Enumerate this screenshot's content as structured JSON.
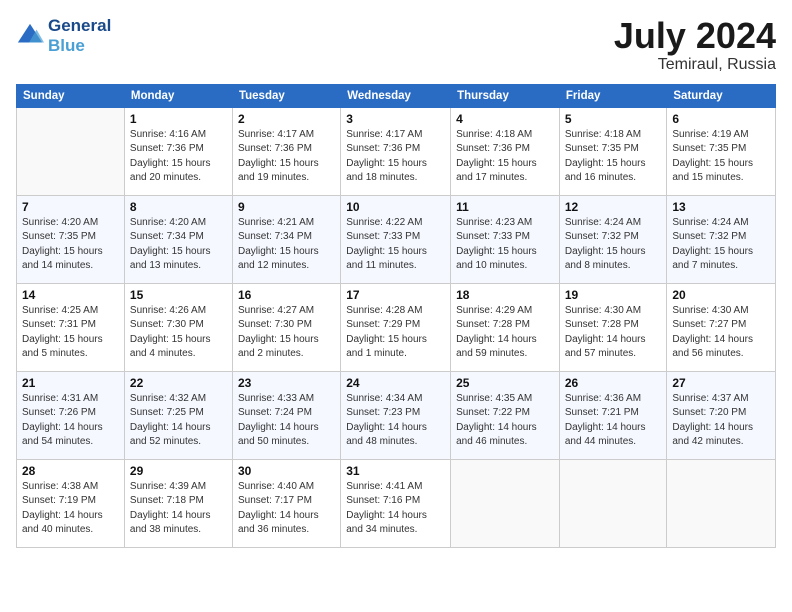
{
  "header": {
    "logo_line1": "General",
    "logo_line2": "Blue",
    "month": "July 2024",
    "location": "Temiraul, Russia"
  },
  "weekdays": [
    "Sunday",
    "Monday",
    "Tuesday",
    "Wednesday",
    "Thursday",
    "Friday",
    "Saturday"
  ],
  "weeks": [
    [
      {
        "day": "",
        "info": ""
      },
      {
        "day": "1",
        "info": "Sunrise: 4:16 AM\nSunset: 7:36 PM\nDaylight: 15 hours\nand 20 minutes."
      },
      {
        "day": "2",
        "info": "Sunrise: 4:17 AM\nSunset: 7:36 PM\nDaylight: 15 hours\nand 19 minutes."
      },
      {
        "day": "3",
        "info": "Sunrise: 4:17 AM\nSunset: 7:36 PM\nDaylight: 15 hours\nand 18 minutes."
      },
      {
        "day": "4",
        "info": "Sunrise: 4:18 AM\nSunset: 7:36 PM\nDaylight: 15 hours\nand 17 minutes."
      },
      {
        "day": "5",
        "info": "Sunrise: 4:18 AM\nSunset: 7:35 PM\nDaylight: 15 hours\nand 16 minutes."
      },
      {
        "day": "6",
        "info": "Sunrise: 4:19 AM\nSunset: 7:35 PM\nDaylight: 15 hours\nand 15 minutes."
      }
    ],
    [
      {
        "day": "7",
        "info": "Sunrise: 4:20 AM\nSunset: 7:35 PM\nDaylight: 15 hours\nand 14 minutes."
      },
      {
        "day": "8",
        "info": "Sunrise: 4:20 AM\nSunset: 7:34 PM\nDaylight: 15 hours\nand 13 minutes."
      },
      {
        "day": "9",
        "info": "Sunrise: 4:21 AM\nSunset: 7:34 PM\nDaylight: 15 hours\nand 12 minutes."
      },
      {
        "day": "10",
        "info": "Sunrise: 4:22 AM\nSunset: 7:33 PM\nDaylight: 15 hours\nand 11 minutes."
      },
      {
        "day": "11",
        "info": "Sunrise: 4:23 AM\nSunset: 7:33 PM\nDaylight: 15 hours\nand 10 minutes."
      },
      {
        "day": "12",
        "info": "Sunrise: 4:24 AM\nSunset: 7:32 PM\nDaylight: 15 hours\nand 8 minutes."
      },
      {
        "day": "13",
        "info": "Sunrise: 4:24 AM\nSunset: 7:32 PM\nDaylight: 15 hours\nand 7 minutes."
      }
    ],
    [
      {
        "day": "14",
        "info": "Sunrise: 4:25 AM\nSunset: 7:31 PM\nDaylight: 15 hours\nand 5 minutes."
      },
      {
        "day": "15",
        "info": "Sunrise: 4:26 AM\nSunset: 7:30 PM\nDaylight: 15 hours\nand 4 minutes."
      },
      {
        "day": "16",
        "info": "Sunrise: 4:27 AM\nSunset: 7:30 PM\nDaylight: 15 hours\nand 2 minutes."
      },
      {
        "day": "17",
        "info": "Sunrise: 4:28 AM\nSunset: 7:29 PM\nDaylight: 15 hours\nand 1 minute."
      },
      {
        "day": "18",
        "info": "Sunrise: 4:29 AM\nSunset: 7:28 PM\nDaylight: 14 hours\nand 59 minutes."
      },
      {
        "day": "19",
        "info": "Sunrise: 4:30 AM\nSunset: 7:28 PM\nDaylight: 14 hours\nand 57 minutes."
      },
      {
        "day": "20",
        "info": "Sunrise: 4:30 AM\nSunset: 7:27 PM\nDaylight: 14 hours\nand 56 minutes."
      }
    ],
    [
      {
        "day": "21",
        "info": "Sunrise: 4:31 AM\nSunset: 7:26 PM\nDaylight: 14 hours\nand 54 minutes."
      },
      {
        "day": "22",
        "info": "Sunrise: 4:32 AM\nSunset: 7:25 PM\nDaylight: 14 hours\nand 52 minutes."
      },
      {
        "day": "23",
        "info": "Sunrise: 4:33 AM\nSunset: 7:24 PM\nDaylight: 14 hours\nand 50 minutes."
      },
      {
        "day": "24",
        "info": "Sunrise: 4:34 AM\nSunset: 7:23 PM\nDaylight: 14 hours\nand 48 minutes."
      },
      {
        "day": "25",
        "info": "Sunrise: 4:35 AM\nSunset: 7:22 PM\nDaylight: 14 hours\nand 46 minutes."
      },
      {
        "day": "26",
        "info": "Sunrise: 4:36 AM\nSunset: 7:21 PM\nDaylight: 14 hours\nand 44 minutes."
      },
      {
        "day": "27",
        "info": "Sunrise: 4:37 AM\nSunset: 7:20 PM\nDaylight: 14 hours\nand 42 minutes."
      }
    ],
    [
      {
        "day": "28",
        "info": "Sunrise: 4:38 AM\nSunset: 7:19 PM\nDaylight: 14 hours\nand 40 minutes."
      },
      {
        "day": "29",
        "info": "Sunrise: 4:39 AM\nSunset: 7:18 PM\nDaylight: 14 hours\nand 38 minutes."
      },
      {
        "day": "30",
        "info": "Sunrise: 4:40 AM\nSunset: 7:17 PM\nDaylight: 14 hours\nand 36 minutes."
      },
      {
        "day": "31",
        "info": "Sunrise: 4:41 AM\nSunset: 7:16 PM\nDaylight: 14 hours\nand 34 minutes."
      },
      {
        "day": "",
        "info": ""
      },
      {
        "day": "",
        "info": ""
      },
      {
        "day": "",
        "info": ""
      }
    ]
  ]
}
